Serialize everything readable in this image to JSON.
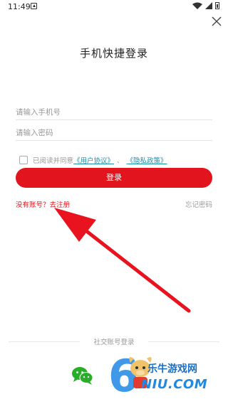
{
  "status_bar": {
    "time": "11:49"
  },
  "page": {
    "title": "手机快捷登录"
  },
  "form": {
    "phone_placeholder": "请输入手机号",
    "password_placeholder": "请输入密码",
    "agree_text": "已阅读并同意",
    "user_agreement": "《用户协议》",
    "separator": "、",
    "privacy_policy": "《隐私政策》",
    "login_label": "登录"
  },
  "links": {
    "no_account": "没有账号？",
    "register": "去注册",
    "forgot_password": "忘记密码"
  },
  "social": {
    "label": "社交账号登录",
    "wechat_icon": "wechat-icon"
  },
  "watermark": {
    "site_name": "乐牛游戏网",
    "domain": "NIU.COM"
  },
  "colors": {
    "accent": "#e2141d",
    "link": "#1a8fa8",
    "wechat": "#2aae2a",
    "arrow": "#e8131e"
  }
}
